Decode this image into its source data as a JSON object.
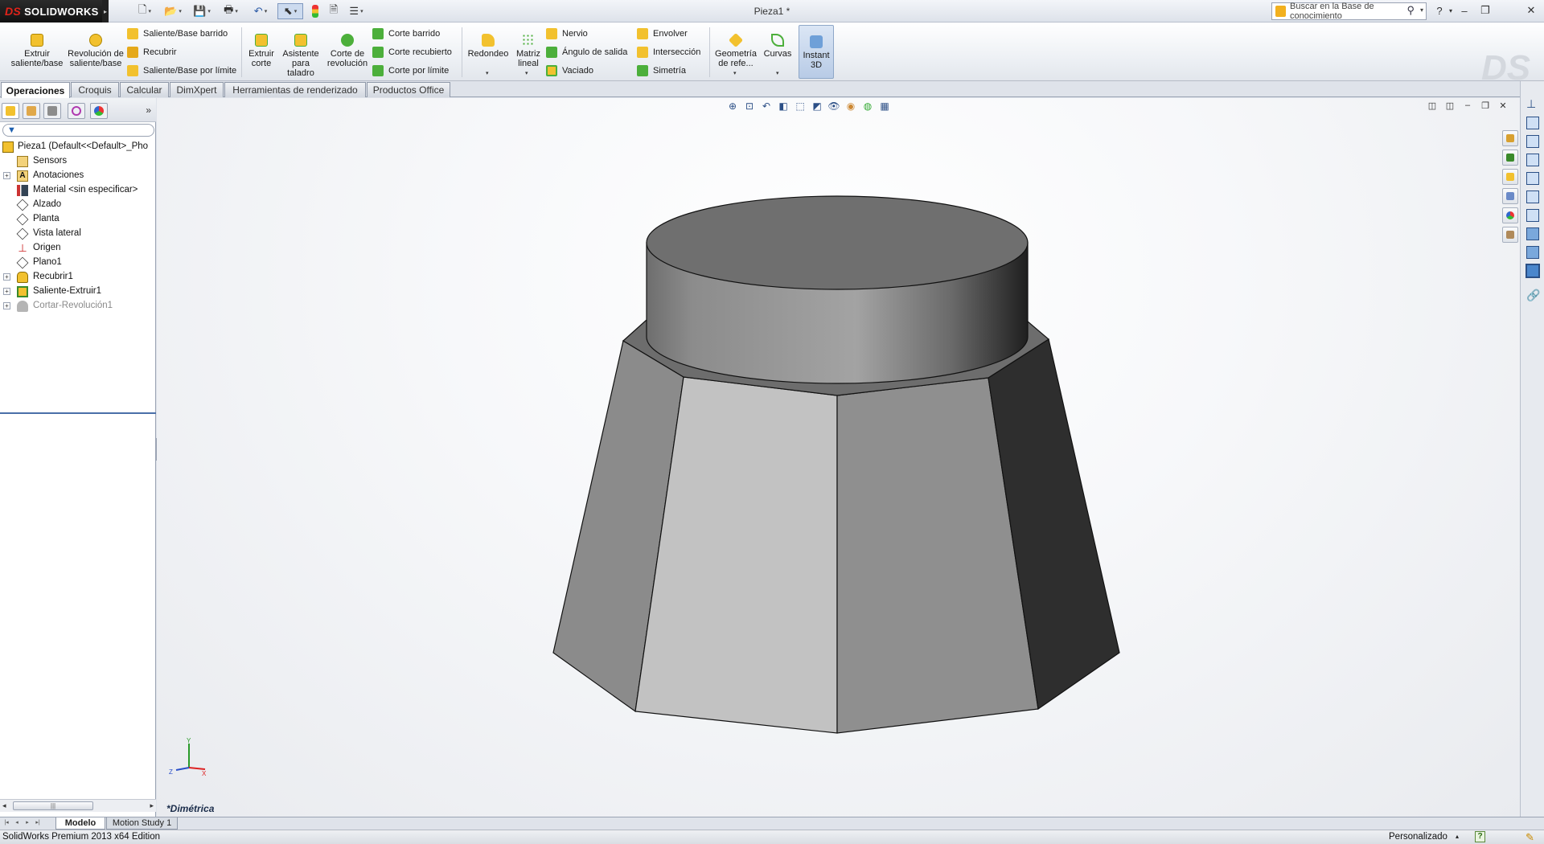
{
  "app": {
    "brand": "SOLIDWORKS",
    "document_title": "Pieza1 *",
    "search_placeholder": "Buscar en la Base de conocimiento"
  },
  "quick_access": [
    "new-icon",
    "open-icon",
    "save-icon",
    "print-icon",
    "undo-icon",
    "select-icon",
    "rebuild-icon",
    "file-properties-icon",
    "options-icon"
  ],
  "commands": {
    "extrude_boss": "Extruir saliente/base",
    "revolve_boss": "Revolución de saliente/base",
    "swept_boss": "Saliente/Base barrido",
    "loft": "Recubrir",
    "boundary_boss": "Saliente/Base por límite",
    "extrude_cut": "Extruir corte",
    "hole_wizard": "Asistente para taladro",
    "revolve_cut": "Corte de revolución",
    "swept_cut": "Corte barrido",
    "lofted_cut": "Corte recubierto",
    "boundary_cut": "Corte por límite",
    "fillet": "Redondeo",
    "linear_pattern": "Matriz lineal",
    "rib": "Nervio",
    "draft": "Ángulo de salida",
    "shell": "Vaciado",
    "wrap": "Envolver",
    "intersect": "Intersección",
    "mirror": "Simetría",
    "ref_geometry": "Geometría de refe...",
    "curves": "Curvas",
    "instant3d": "Instant 3D"
  },
  "tabs": [
    "Operaciones",
    "Croquis",
    "Calcular",
    "DimXpert",
    "Herramientas de renderizado",
    "Productos Office"
  ],
  "feature_tree": {
    "root": "Pieza1  (Default<<Default>_Pho",
    "items": [
      {
        "label": "Sensors",
        "icon": "sensors-icon",
        "expandable": false
      },
      {
        "label": "Anotaciones",
        "icon": "annotations-icon",
        "expandable": true
      },
      {
        "label": "Material <sin especificar>",
        "icon": "material-icon",
        "expandable": false
      },
      {
        "label": "Alzado",
        "icon": "plane-icon",
        "expandable": false
      },
      {
        "label": "Planta",
        "icon": "plane-icon",
        "expandable": false
      },
      {
        "label": "Vista lateral",
        "icon": "plane-icon",
        "expandable": false
      },
      {
        "label": "Origen",
        "icon": "origin-icon",
        "expandable": false
      },
      {
        "label": "Plano1",
        "icon": "plane-icon",
        "expandable": false
      },
      {
        "label": "Recubrir1",
        "icon": "loft-feature-icon",
        "expandable": true
      },
      {
        "label": "Saliente-Extruir1",
        "icon": "extrude-feature-icon",
        "expandable": true
      },
      {
        "label": "Cortar-Revolución1",
        "icon": "revolve-cut-feature-icon",
        "expandable": true,
        "suppressed": true
      }
    ]
  },
  "viewport": {
    "view_orientation": "*Dimétrica",
    "triad_labels": {
      "x": "X",
      "y": "Y",
      "z": "Z"
    }
  },
  "bottom_tabs": [
    "Modelo",
    "Motion Study 1"
  ],
  "status": {
    "edition": "SolidWorks Premium 2013 x64 Edition",
    "units": "Personalizado",
    "help": "?"
  },
  "colors": {
    "accent": "#4a6fa8",
    "brand_red": "#e2231a",
    "icon_yellow": "#f2c12e",
    "icon_green": "#4caf3b"
  }
}
